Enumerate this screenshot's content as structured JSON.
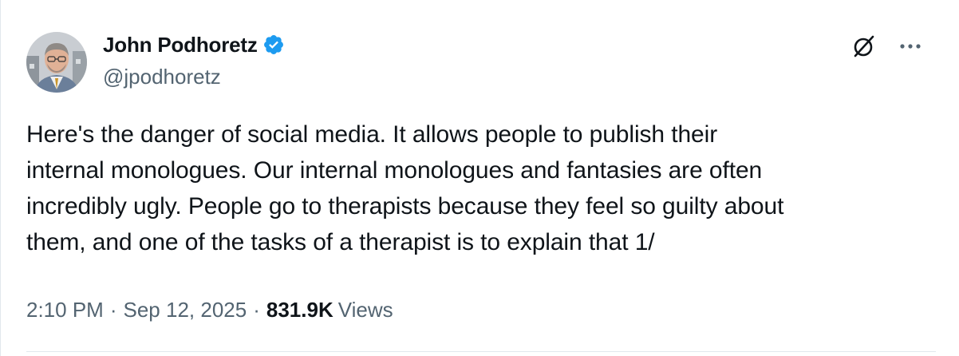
{
  "author": {
    "display_name": "John Podhoretz",
    "handle": "@jpodhoretz",
    "verified_badge_color": "#1d9bf0"
  },
  "actions": {
    "grok_icon": "grok-icon",
    "more_icon": "more-dots-icon"
  },
  "tweet": {
    "lines": [
      "Here's the danger of social media. It allows people to publish their",
      "internal monologues. Our internal monologues and fantasies are often",
      "incredibly ugly. People go to therapists because they feel so guilty about",
      "them, and one of the tasks of a therapist is to explain that  1/"
    ]
  },
  "meta": {
    "time": "2:10 PM",
    "separator": "·",
    "date": "Sep 12, 2025",
    "views_count": "831.9K",
    "views_label": "Views"
  },
  "colors": {
    "text_primary": "#0f1419",
    "text_secondary": "#536471",
    "divider": "#e1e8ed"
  }
}
